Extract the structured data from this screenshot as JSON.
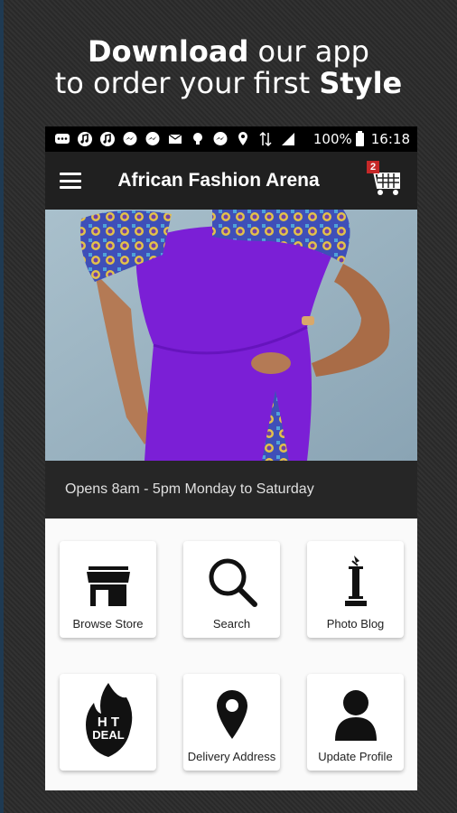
{
  "promo": {
    "line1_bold": "Download",
    "line1_rest": " our app",
    "line2_rest": "to order your first ",
    "line2_bold": "Style"
  },
  "status_bar": {
    "battery": "100%",
    "time": "16:18",
    "icons": [
      "chat-icon",
      "music-icon",
      "music-icon",
      "messenger-icon",
      "messenger-icon",
      "mail-icon",
      "bulb-icon",
      "messenger-icon",
      "location-icon",
      "data-icon",
      "signal-icon",
      "battery-icon"
    ]
  },
  "app_bar": {
    "title": "African Fashion Arena",
    "cart_count": "2"
  },
  "hours": "Opens 8am - 5pm Monday to Saturday",
  "tiles": [
    {
      "label": "Browse Store",
      "icon": "store-icon"
    },
    {
      "label": "Search",
      "icon": "search-icon"
    },
    {
      "label": "Photo Blog",
      "icon": "photo-blog-icon"
    },
    {
      "label": "Delivery Address",
      "icon": "location-pin-icon"
    },
    {
      "label": "Update Profile",
      "icon": "user-profile-icon"
    }
  ],
  "hot_deal": {
    "text_top": "H T",
    "text_bottom": "DEAL"
  },
  "colors": {
    "background": "#2b2b2b",
    "app_bar": "#202020",
    "badge": "#c62828",
    "dress": "#7b1fd6"
  }
}
